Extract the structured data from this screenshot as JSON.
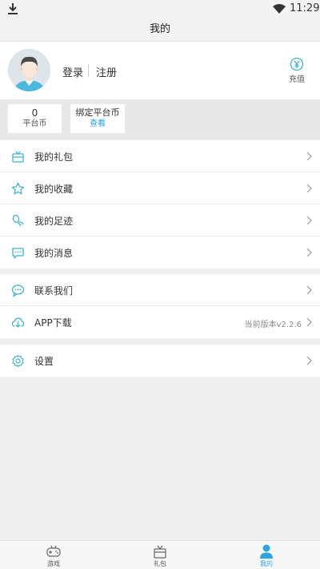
{
  "status_bar": {
    "time": "11:29"
  },
  "title": "我的",
  "profile": {
    "login": "登录",
    "register": "注册",
    "recharge": "充值"
  },
  "coins": {
    "platform": {
      "value": "0",
      "label": "平台币"
    },
    "bound": {
      "label": "绑定平台币",
      "action": "查看"
    }
  },
  "menu_group_1": [
    {
      "label": "我的礼包",
      "icon": "gift-icon"
    },
    {
      "label": "我的收藏",
      "icon": "star-icon"
    },
    {
      "label": "我的足迹",
      "icon": "footprint-icon"
    },
    {
      "label": "我的消息",
      "icon": "message-icon"
    }
  ],
  "menu_group_2": [
    {
      "label": "联系我们",
      "icon": "chat-icon"
    },
    {
      "label": "APP下载",
      "icon": "cloud-download-icon",
      "version": "当前版本v2.2.6"
    }
  ],
  "menu_group_3": [
    {
      "label": "设置",
      "icon": "settings-icon"
    }
  ],
  "tabs": [
    {
      "label": "游戏",
      "icon": "gamepad-icon"
    },
    {
      "label": "礼包",
      "icon": "gift-box-icon"
    },
    {
      "label": "我的",
      "icon": "user-icon"
    }
  ],
  "colors": {
    "accent": "#2ba6e1",
    "icon": "#3db3cf"
  }
}
